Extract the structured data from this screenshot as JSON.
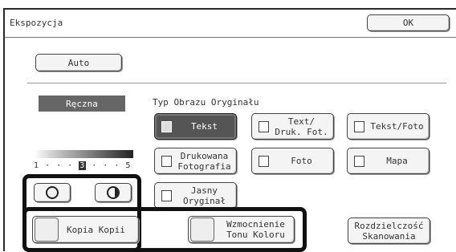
{
  "header": {
    "title": "Ekspozycja",
    "ok_label": "OK"
  },
  "auto_label": "Auto",
  "manual_label": "Ręczna",
  "original_type": {
    "label": "Typ Obrazu Oryginału",
    "buttons": {
      "tekst": "Tekst",
      "text_druk": "Text/\nDruk. Fot.",
      "tekst_foto": "Tekst/Foto",
      "drukowana": "Drukowana\nFotografia",
      "foto": "Foto",
      "mapa": "Mapa",
      "jasny": "Jasny\nOryginał"
    },
    "selected": "Tekst"
  },
  "exposure_scale": {
    "min": "1",
    "max": "5",
    "value": "3",
    "dots": "· · ·"
  },
  "bottom": {
    "kopia_kopii": "Kopia Kopii",
    "wzmocnienie": "Wzmocnienie\nTonu Koloru",
    "rozdzielczosc": "Rozdzielczość\nSkanowania"
  }
}
